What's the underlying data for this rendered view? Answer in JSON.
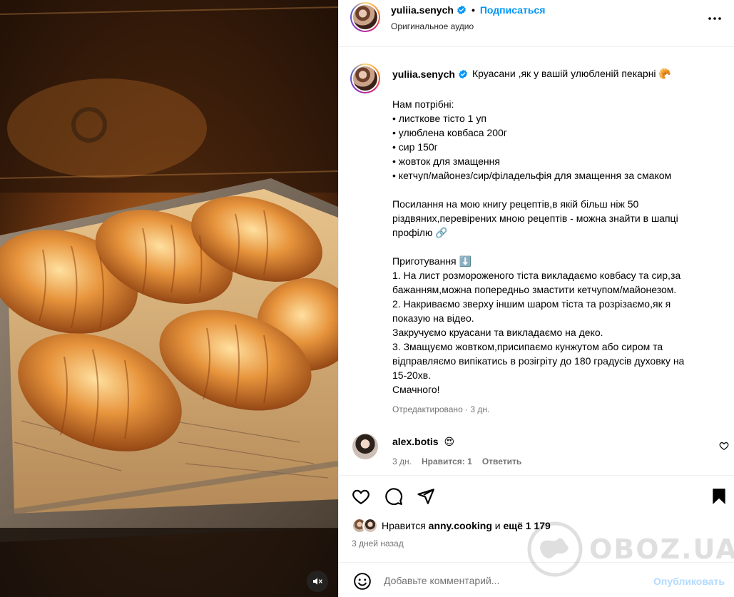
{
  "header": {
    "username": "yuliia.senych",
    "separator": "•",
    "follow_label": "Подписаться",
    "subtitle": "Оригинальное аудио",
    "icons": {
      "verified": "verified-badge-icon",
      "more": "more-options-icon"
    }
  },
  "caption": {
    "username": "yuliia.senych",
    "title": "Круасани ,як у вашій улюбленій пекарні 🥐",
    "lines": [
      "Нам потрібні:",
      "• листкове тісто 1 уп",
      "• улюблена ковбаса 200г",
      "• сир 150г",
      "• жовток для змащення",
      "• кетчуп/майонез/сир/філадельфія для змащення за смаком",
      "",
      "Посилання на мою книгу рецептів,в якій більш ніж 50",
      "різдвяних,перевірених мною рецептів - можна знайти в шапці",
      "профілю 🔗",
      "",
      "Приготування ⬇️",
      "1. На лист розмороженого тіста викладаємо ковбасу та сир,за",
      "бажанням,можна попередньо змастити кетчупом/майонезом.",
      "2. Накриваємо зверху іншим шаром тіста та розрізаємо,як я",
      "показую на відео.",
      "Закручуємо круасани та викладаємо на деко.",
      "3. Змащуємо жовтком,присипаємо кунжутом або сиром та",
      "відправляємо випікатись в розігріту до 180 градусів духовку на",
      "15-20хв.",
      "Смачного!"
    ],
    "edited": "Отредактировано",
    "edited_sep": " · ",
    "edited_time": "3 дн."
  },
  "comment": {
    "username": "alex.botis",
    "text": "😍",
    "time": "3 дн.",
    "likes": "Нравится: 1",
    "reply": "Ответить",
    "icons": {
      "like": "heart-outline-icon"
    }
  },
  "actions": {
    "icons": [
      "heart-outline-icon",
      "comment-bubble-icon",
      "share-paper-plane-icon",
      "bookmark-filled-icon"
    ]
  },
  "likes": {
    "prefix": "Нравится",
    "user": "anny.cooking",
    "connector": "и",
    "more": "ещё 1 179"
  },
  "date": "3 дней назад",
  "composer": {
    "placeholder": "Добавьте комментарий...",
    "publish_label": "Опубликовать"
  },
  "media": {
    "icons": {
      "mute": "speaker-muted-icon"
    }
  },
  "watermark": {
    "text": "OBOZ.UA"
  },
  "colors": {
    "accent": "#0095f6",
    "muted_text": "#737373",
    "border": "#efefef",
    "publish_disabled": "#b3dbff"
  }
}
